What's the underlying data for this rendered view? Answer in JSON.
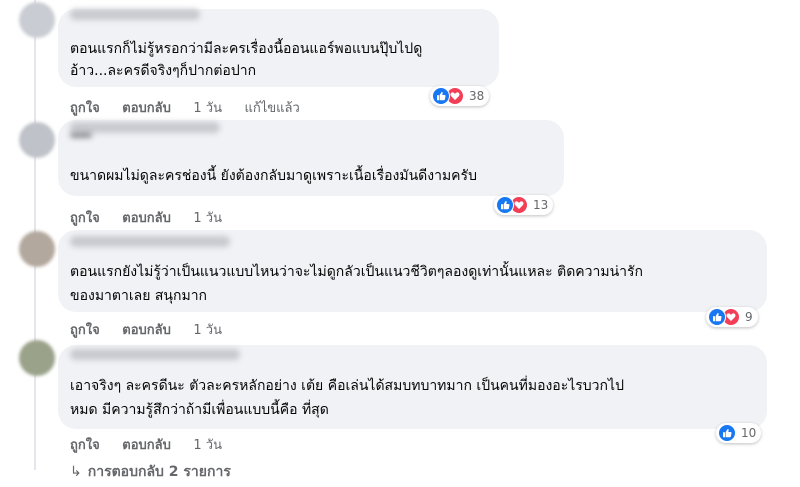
{
  "comments": [
    {
      "lines": [
        "ตอนแรกก็ไม่รู้หรอกว่ามีละครเรื่องนี้ออนแอร์พอแบนปุ๊บไปดู",
        "อ้าว...ละครดีจริงๆก็ปากต่อปาก"
      ],
      "like_label": "ถูกใจ",
      "reply_label": "ตอบกลับ",
      "time": "1 วัน",
      "edited": "แก้ไขแล้ว",
      "reaction_icons": [
        "like-icon",
        "love-icon"
      ],
      "reaction_count": "38"
    },
    {
      "lines": [
        "ขนาดผมไม่ดูละครช่องนี้ ยังต้องกลับมาดูเพราะเนื้อเรื่องมันดีงามครับ"
      ],
      "like_label": "ถูกใจ",
      "reply_label": "ตอบกลับ",
      "time": "1 วัน",
      "reaction_icons": [
        "like-icon",
        "love-icon"
      ],
      "reaction_count": "13"
    },
    {
      "lines": [
        "ตอนแรกยังไม่รู้ว่าเป็นแนวแบบไหนว่าจะไม่ดูกลัวเป็นแนวชีวิตๆลองดูเท่านั้นแหละ ติดความน่ารัก",
        "ของมาตาเลย สนุกมาก"
      ],
      "like_label": "ถูกใจ",
      "reply_label": "ตอบกลับ",
      "time": "1 วัน",
      "reaction_icons": [
        "like-icon",
        "love-icon"
      ],
      "reaction_count": "9"
    },
    {
      "lines": [
        "เอาจริงๆ ละครดีนะ ตัวละครหลักอย่าง เต้ย คือเล่นได้สมบทบาทมาก เป็นคนที่มองอะไรบวกไป",
        "หมด มีความรู้สึกว่าถ้ามีเพื่อนแบบนี้คือ ที่สุด"
      ],
      "like_label": "ถูกใจ",
      "reply_label": "ตอบกลับ",
      "time": "1 วัน",
      "reaction_icons": [
        "like-icon"
      ],
      "reaction_count": "10"
    }
  ],
  "replies_link": "การตอบกลับ 2 รายการ",
  "colors": {
    "bubble": "#f0f2f5",
    "like": "#1877f2",
    "love": "#f33e58",
    "muted_text": "#65676b"
  }
}
